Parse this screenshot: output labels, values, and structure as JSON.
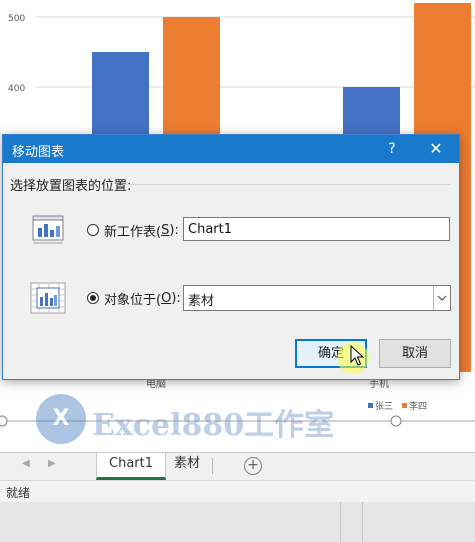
{
  "chart_data": {
    "type": "bar",
    "categories": [
      "电脑",
      "手机"
    ],
    "series": [
      {
        "name": "张三",
        "values": [
          450,
          400
        ],
        "color": "#4472c4"
      },
      {
        "name": "李四",
        "values": [
          500,
          520
        ],
        "color": "#ed7d31"
      }
    ],
    "yticks": [
      "500",
      "400"
    ],
    "ylim": [
      0,
      520
    ],
    "legend_position": "bottom-right"
  },
  "dialog": {
    "title": "移动图表",
    "help": "?",
    "close": "✕",
    "instruction": "选择放置图表的位置:",
    "new_sheet_label": "新工作表(",
    "new_sheet_key": "S",
    "new_sheet_end": "):",
    "new_sheet_value": "Chart1",
    "object_label": "对象位于(",
    "object_key": "O",
    "object_end": "):",
    "object_value": "素材",
    "ok": "确定",
    "cancel": "取消",
    "selected_option": "object"
  },
  "tabs": [
    {
      "label": "Chart1",
      "active": true
    },
    {
      "label": "素材",
      "active": false
    }
  ],
  "add_sheet": "+",
  "status": "就绪",
  "watermark": {
    "logo": "X",
    "text": "Excel880工作室"
  },
  "icons": [
    "new-sheet-chart-icon",
    "object-chart-icon",
    "close-icon",
    "help-icon",
    "dropdown-arrow-icon",
    "add-sheet-icon",
    "mouse-cursor-icon"
  ]
}
